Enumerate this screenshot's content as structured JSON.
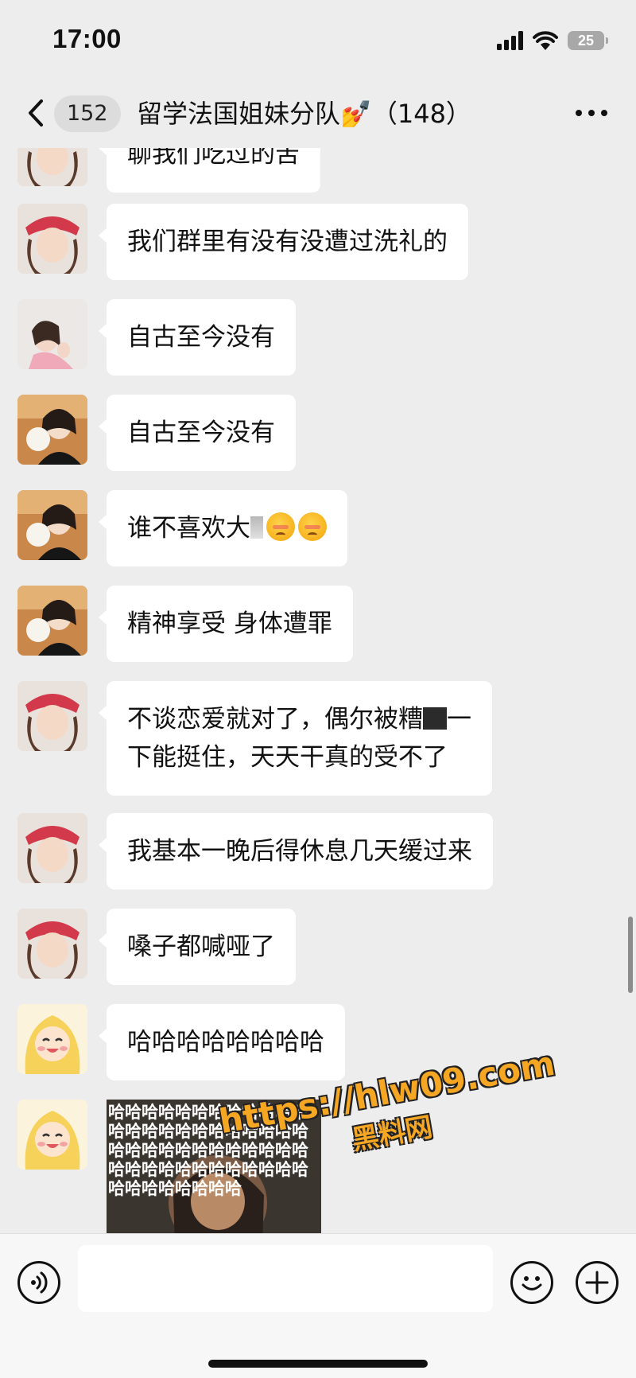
{
  "status_bar": {
    "time": "17:00",
    "battery": "25"
  },
  "header": {
    "unread_count": "152",
    "title": "留学法国姐妹分队💅（148）"
  },
  "messages": [
    {
      "text": "聊我们吃过的苦",
      "avatar": "red-hat-girl"
    },
    {
      "text": "我们群里有没有没遭过洗礼的",
      "avatar": "red-hat-girl"
    },
    {
      "text": "自古至今没有",
      "avatar": "pink-sweater-girl"
    },
    {
      "text": "自古至今没有",
      "avatar": "plush-toy-girl"
    },
    {
      "text": "谁不喜欢大",
      "avatar": "plush-toy-girl"
    },
    {
      "text": "精神享受 身体遭罪",
      "avatar": "plush-toy-girl"
    },
    {
      "line1_a": "不谈恋爱就对了，偶尔被糟",
      "line1_b": "一",
      "line2": "下能挺住，天天干真的受不了",
      "avatar": "red-hat-girl"
    },
    {
      "text": "我基本一晚后得休息几天缓过来",
      "avatar": "red-hat-girl"
    },
    {
      "text": "嗓子都喊哑了",
      "avatar": "red-hat-girl"
    },
    {
      "text": "哈哈哈哈哈哈哈哈",
      "avatar": "cartoon-blonde"
    },
    {
      "meme_text": "哈哈哈哈哈哈哈哈哈哈哈哈哈哈哈哈哈哈哈哈哈哈哈哈哈哈哈哈哈哈哈哈哈哈哈哈哈哈哈哈哈哈哈哈哈哈哈哈哈哈哈哈哈哈哈哈",
      "avatar": "cartoon-blonde"
    }
  ],
  "watermark": {
    "url": "https://hlw09.com",
    "name": "黑料网"
  },
  "colors": {
    "background": "#ededed",
    "bubble": "#ffffff",
    "watermark": "#f5a623"
  },
  "icons": [
    "back-icon",
    "more-icon",
    "voice-icon",
    "emoji-icon",
    "add-icon"
  ]
}
